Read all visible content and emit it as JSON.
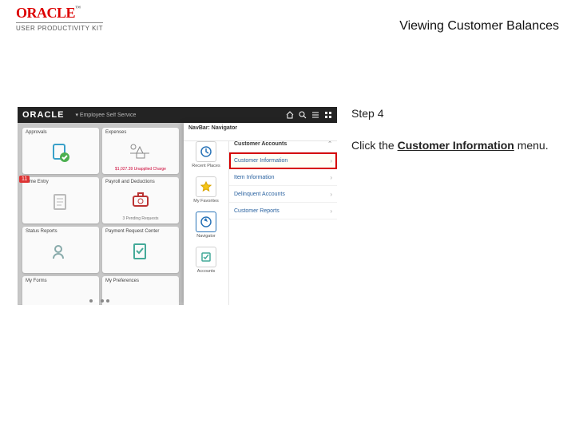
{
  "header": {
    "brand": "ORACLE",
    "suite": "USER PRODUCTIVITY KIT",
    "title": "Viewing Customer Balances"
  },
  "instruction": {
    "step_label": "Step 4",
    "prefix": "Click the ",
    "target": "Customer Information",
    "suffix": " menu."
  },
  "app": {
    "brand": "ORACLE",
    "breadcrumb": "Employee Self Service",
    "tiles": [
      {
        "label": "Approvals",
        "foot": ""
      },
      {
        "label": "Expenses",
        "foot": "$1,027.39 Unapplied Charge"
      },
      {
        "label": "Time Entry",
        "foot": ""
      },
      {
        "label": "Payroll and Deductions",
        "foot": "3 Pending Requests"
      },
      {
        "label": "Status Reports",
        "foot": ""
      },
      {
        "label": "Payment Request Center",
        "foot": ""
      },
      {
        "label": "My Forms",
        "foot": ""
      },
      {
        "label": "My Preferences",
        "foot": ""
      }
    ],
    "badge": "11",
    "navbar": {
      "header": "NavBar: Navigator",
      "column": [
        {
          "label": "Recent Places"
        },
        {
          "label": "My Favorites"
        },
        {
          "label": "Navigator"
        },
        {
          "label": "Accounts"
        }
      ],
      "list_header": "Customer Accounts",
      "items": [
        {
          "label": "Customer Information",
          "highlight": true
        },
        {
          "label": "Item Information",
          "highlight": false
        },
        {
          "label": "Delinquent Accounts",
          "highlight": false
        },
        {
          "label": "Customer Reports",
          "highlight": false
        }
      ]
    }
  }
}
